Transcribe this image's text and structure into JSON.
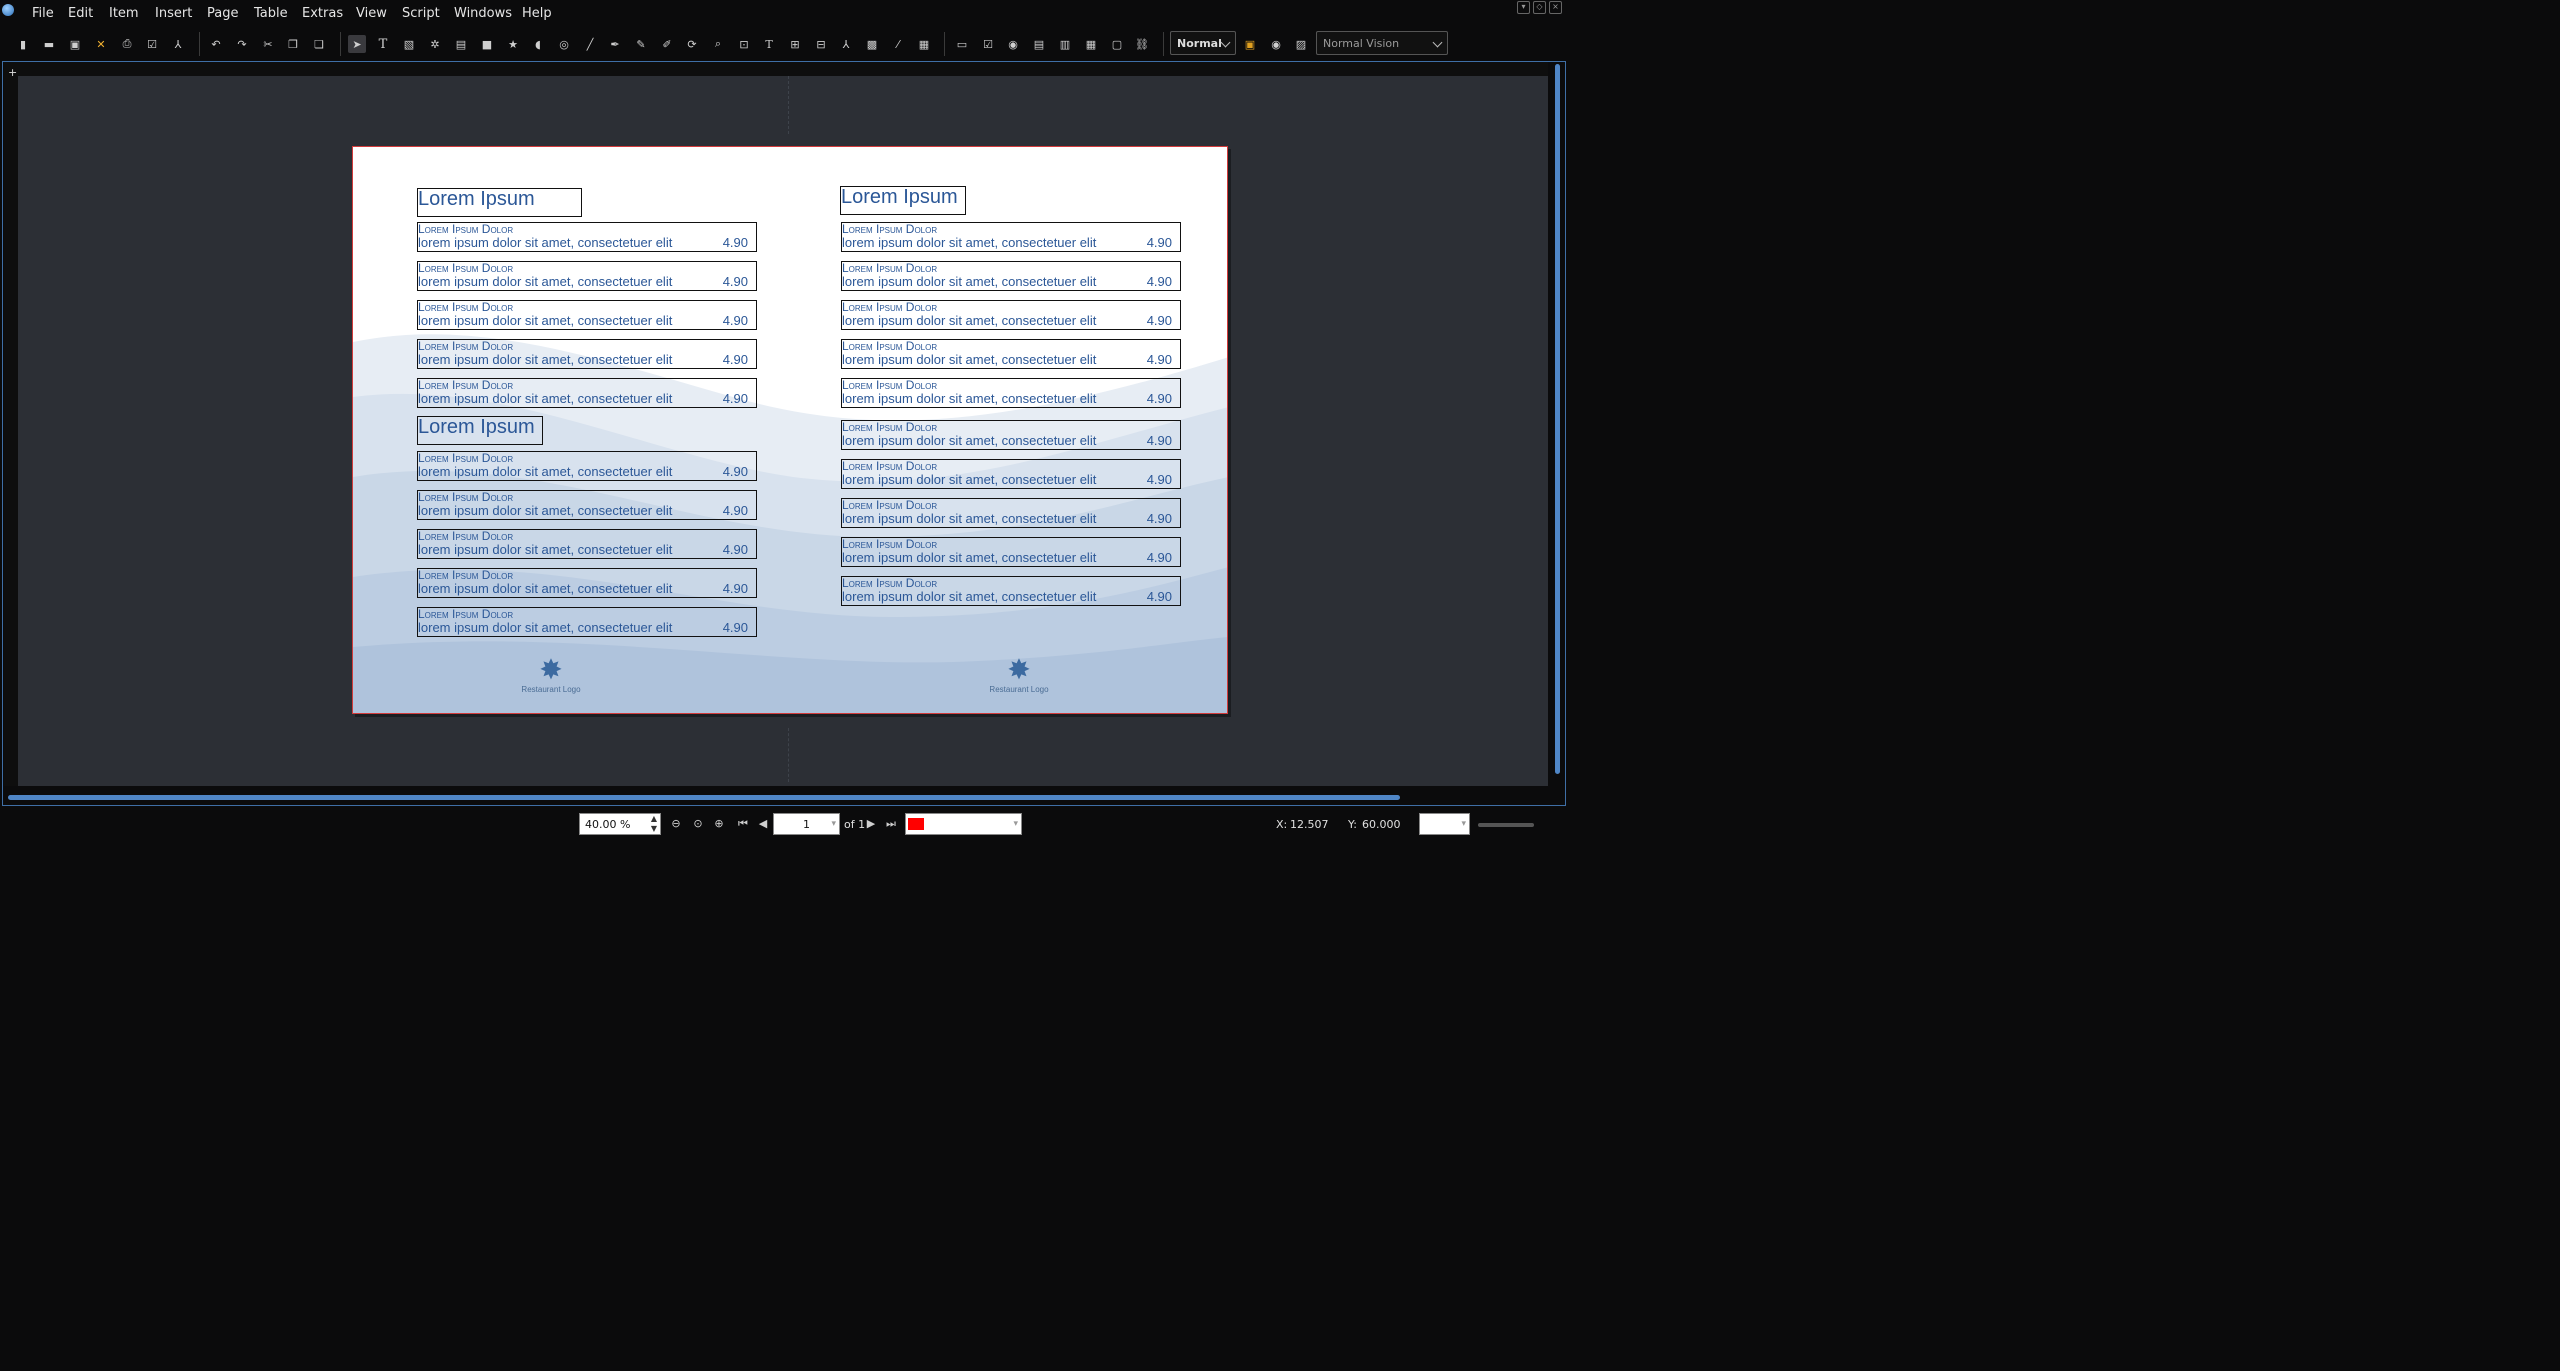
{
  "menubar": {
    "items": [
      "File",
      "Edit",
      "Item",
      "Insert",
      "Page",
      "Table",
      "Extras",
      "View",
      "Script",
      "Windows",
      "Help"
    ]
  },
  "toolbar": {
    "mode_combo": "Normal",
    "vision_combo": "Normal Vision",
    "icons": [
      "new-document-icon",
      "open-document-icon",
      "save-icon",
      "close-document-icon",
      "print-icon",
      "preflight-check-icon",
      "export-pdf-icon",
      "undo-icon",
      "redo-icon",
      "cut-icon",
      "copy-icon",
      "paste-icon",
      "select-icon",
      "text-frame-icon",
      "image-frame-icon",
      "render-frame-icon",
      "table-icon",
      "shape-icon",
      "polygon-icon",
      "arc-icon",
      "spiral-icon",
      "line-icon",
      "bezier-icon",
      "freehand-icon",
      "calligraphic-icon",
      "rotate-icon",
      "zoom-icon",
      "edit-contents-icon",
      "edit-text-icon",
      "link-frames-icon",
      "unlink-frames-icon",
      "measure-icon",
      "copy-properties-icon",
      "eyedropper-icon",
      "table-edit-icon",
      "pdf-push-button-icon",
      "pdf-checkbox-icon",
      "pdf-radio-icon",
      "pdf-text-field-icon",
      "pdf-combobox-icon",
      "pdf-listbox-icon",
      "pdf-annotation-icon",
      "pdf-link-icon",
      "color-management-icon",
      "preview-icon",
      "edit-mode-icon"
    ]
  },
  "document": {
    "left_column": {
      "headings": [
        "Lorem Ipsum",
        "Lorem Ipsum"
      ],
      "items": [
        {
          "name": "Lorem Ipsum Dolor",
          "desc": "lorem ipsum dolor sit amet, consectetuer elit",
          "price": "4.90"
        },
        {
          "name": "Lorem Ipsum Dolor",
          "desc": "lorem ipsum dolor sit amet, consectetuer elit",
          "price": "4.90"
        },
        {
          "name": "Lorem Ipsum Dolor",
          "desc": "lorem ipsum dolor sit amet, consectetuer elit",
          "price": "4.90"
        },
        {
          "name": "Lorem Ipsum Dolor",
          "desc": "lorem ipsum dolor sit amet, consectetuer elit",
          "price": "4.90"
        },
        {
          "name": "Lorem Ipsum Dolor",
          "desc": "lorem ipsum dolor sit amet, consectetuer elit",
          "price": "4.90"
        },
        {
          "name": "Lorem Ipsum Dolor",
          "desc": "lorem ipsum dolor sit amet, consectetuer elit",
          "price": "4.90"
        },
        {
          "name": "Lorem Ipsum Dolor",
          "desc": "lorem ipsum dolor sit amet, consectetuer elit",
          "price": "4.90"
        },
        {
          "name": "Lorem Ipsum Dolor",
          "desc": "lorem ipsum dolor sit amet, consectetuer elit",
          "price": "4.90"
        },
        {
          "name": "Lorem Ipsum Dolor",
          "desc": "lorem ipsum dolor sit amet, consectetuer elit",
          "price": "4.90"
        },
        {
          "name": "Lorem Ipsum Dolor",
          "desc": "lorem ipsum dolor sit amet, consectetuer elit",
          "price": "4.90"
        }
      ]
    },
    "right_column": {
      "headings": [
        "Lorem Ipsum"
      ],
      "items": [
        {
          "name": "Lorem Ipsum Dolor",
          "desc": "lorem ipsum dolor sit amet, consectetuer elit",
          "price": "4.90"
        },
        {
          "name": "Lorem Ipsum Dolor",
          "desc": "lorem ipsum dolor sit amet, consectetuer elit",
          "price": "4.90"
        },
        {
          "name": "Lorem Ipsum Dolor",
          "desc": "lorem ipsum dolor sit amet, consectetuer elit",
          "price": "4.90"
        },
        {
          "name": "Lorem Ipsum Dolor",
          "desc": "lorem ipsum dolor sit amet, consectetuer elit",
          "price": "4.90"
        },
        {
          "name": "Lorem Ipsum Dolor",
          "desc": "lorem ipsum dolor sit amet, consectetuer elit",
          "price": "4.90"
        },
        {
          "name": "Lorem Ipsum Dolor",
          "desc": "lorem ipsum dolor sit amet, consectetuer elit",
          "price": "4.90"
        },
        {
          "name": "Lorem Ipsum Dolor",
          "desc": "lorem ipsum dolor sit amet, consectetuer elit",
          "price": "4.90"
        },
        {
          "name": "Lorem Ipsum Dolor",
          "desc": "lorem ipsum dolor sit amet, consectetuer elit",
          "price": "4.90"
        },
        {
          "name": "Lorem Ipsum Dolor",
          "desc": "lorem ipsum dolor sit amet, consectetuer elit",
          "price": "4.90"
        },
        {
          "name": "Lorem Ipsum Dolor",
          "desc": "lorem ipsum dolor sit amet, consectetuer elit",
          "price": "4.90"
        }
      ]
    },
    "logo_label": "Restaurant Logo"
  },
  "statusbar": {
    "zoom": "40.00 %",
    "page_number": "1",
    "page_total": "of 1",
    "layer_color": "#ff0000",
    "x_label": "X:",
    "x_value": "12.507",
    "y_label": "Y:",
    "y_value": "60.000"
  },
  "colors": {
    "accent": "#4f86c6",
    "menu_text": "#2b5797",
    "page_border": "#d23b3b"
  }
}
